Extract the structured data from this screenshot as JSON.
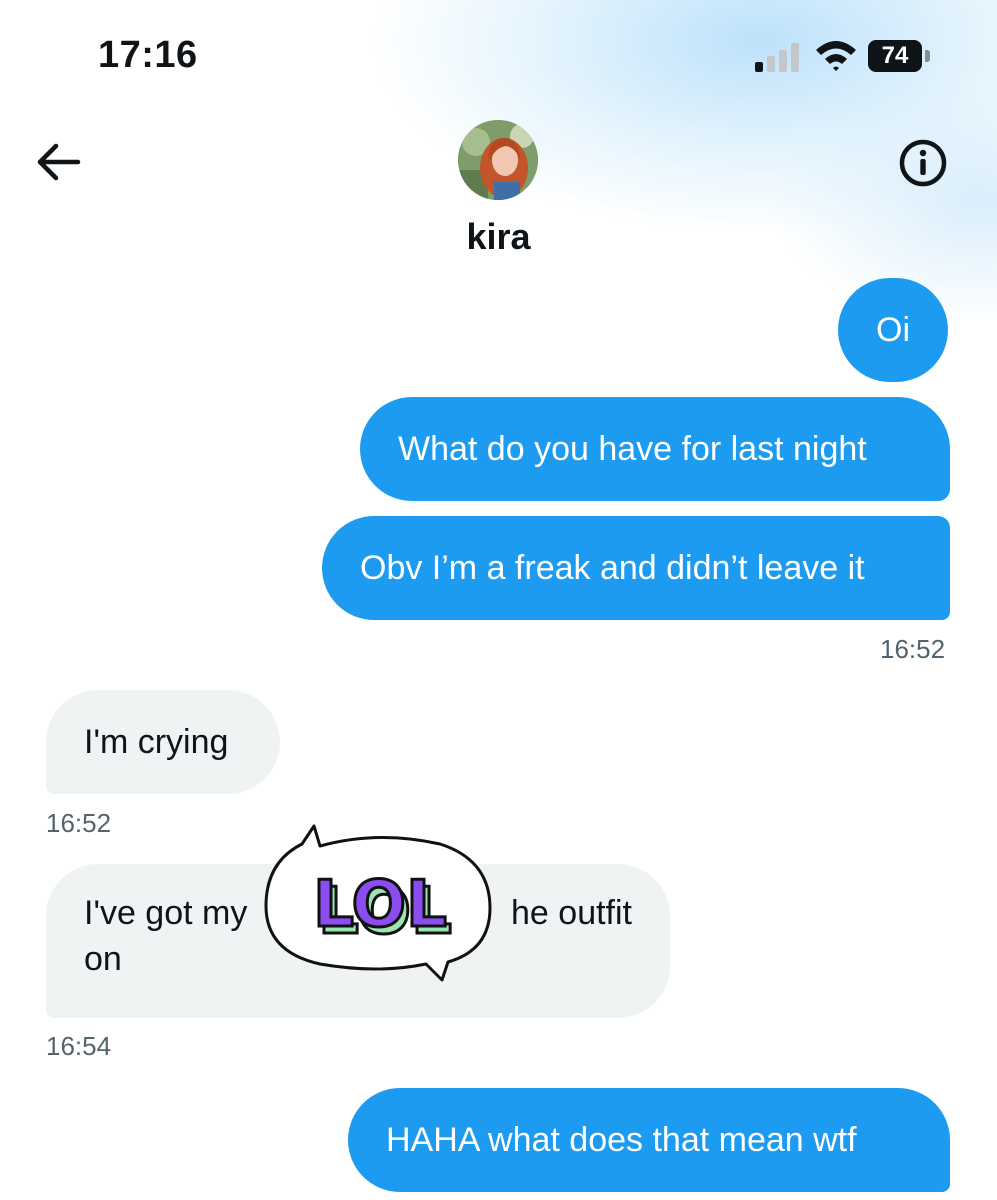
{
  "status_bar": {
    "time": "17:16",
    "battery": "74"
  },
  "header": {
    "name": "kira"
  },
  "messages": [
    {
      "text": "Oi"
    },
    {
      "text": "What do you have for last night"
    },
    {
      "text": "Obv I’m a freak and didn’t leave it",
      "time": "16:52"
    },
    {
      "text": "I'm crying",
      "time": "16:52"
    },
    {
      "text_line1": "I've got my",
      "text_line1_end": "he outfit",
      "text_line2": "on",
      "time": "16:54"
    },
    {
      "text": "HAHA what does that mean wtf"
    }
  ],
  "sticker": {
    "text": "LOL"
  },
  "colors": {
    "outgoing_bubble": "#1d9bf0",
    "incoming_bubble": "#eff3f4",
    "timestamp": "#536471"
  }
}
